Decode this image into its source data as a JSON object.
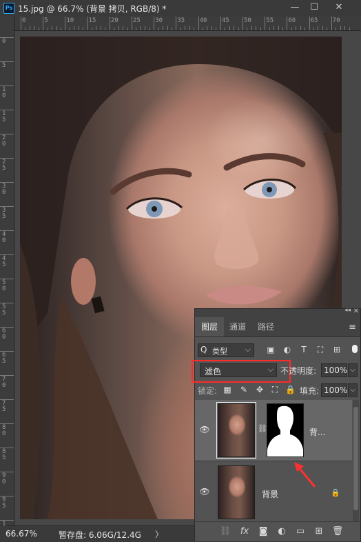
{
  "window": {
    "app_icon": "Ps",
    "title": "15.jpg @ 66.7% (背景 拷贝, RGB/8) *",
    "minimize": "—",
    "maximize": "☐",
    "close": "✕"
  },
  "rulers": {
    "top_labels": [
      "0",
      "5",
      "10",
      "15",
      "20",
      "25",
      "30",
      "35",
      "40",
      "45",
      "50",
      "55",
      "60",
      "65",
      "70"
    ],
    "left_labels": [
      "0",
      "5",
      "10",
      "15",
      "20",
      "25",
      "30",
      "35",
      "40",
      "45",
      "50",
      "55",
      "60",
      "65",
      "70",
      "75",
      "80",
      "85",
      "90",
      "95",
      "100"
    ]
  },
  "status": {
    "zoom": "66.67%",
    "scratch": "暂存盘: 6.06G/12.4G",
    "arrow": "〉"
  },
  "layers_panel": {
    "collapse": "◂◂",
    "close": "✕",
    "tabs": {
      "layers": "图层",
      "channels": "通道",
      "paths": "路径"
    },
    "menu_icon": "≡",
    "filter": {
      "label": "类型",
      "search_icon": "Q",
      "chevron": "⌵"
    },
    "filter_icons": {
      "image": "▣",
      "adjust": "◐",
      "type": "T",
      "shape": "⛶",
      "smart": "⊞"
    },
    "blend_mode": {
      "value": "滤色",
      "chevron": "⌵",
      "highlight_color": "#ff2b2b"
    },
    "opacity": {
      "label": "不透明度:",
      "value": "100%",
      "chevron": "⌵"
    },
    "lock": {
      "label": "锁定:",
      "icons": {
        "pixels": "▦",
        "paint": "✎",
        "move": "✥",
        "artboard": "⛶",
        "all": "🔒"
      }
    },
    "fill": {
      "label": "填充:",
      "value": "100%",
      "chevron": "⌵"
    },
    "layers": [
      {
        "name": "背...",
        "visible_icon": "👁",
        "chain": "⛓",
        "selected": true
      },
      {
        "name": "背景",
        "visible_icon": "👁",
        "lock_icon": "🔒",
        "selected": false
      }
    ],
    "bottom_icons": {
      "link": "⛓",
      "fx": "fx",
      "mask": "◙",
      "adjustment": "◐",
      "group": "▭",
      "new": "⊞",
      "trash": "🗑"
    }
  },
  "annotation_arrow_color": "#ff3030"
}
